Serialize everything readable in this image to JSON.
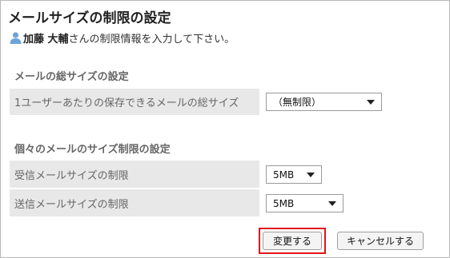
{
  "page": {
    "title": "メールサイズの制限の設定",
    "user_name": "加藤 大輔",
    "user_suffix": "さんの制限情報を入力して下さい。"
  },
  "total_section": {
    "title": "メールの総サイズの設定",
    "label": "1ユーザーあたりの保存できるメールの総サイズ",
    "value": "（無制限）"
  },
  "per_mail_section": {
    "title": "個々のメールのサイズ制限の設定",
    "receive_label": "受信メールサイズの制限",
    "receive_value": "5MB",
    "send_label": "送信メールサイズの制限",
    "send_value": "5MB"
  },
  "buttons": {
    "submit": "変更する",
    "cancel": "キャンセルする"
  },
  "colors": {
    "highlight_border": "#e0151b",
    "label_background": "#e8e8e8",
    "user_icon": "#6fa3d8"
  }
}
